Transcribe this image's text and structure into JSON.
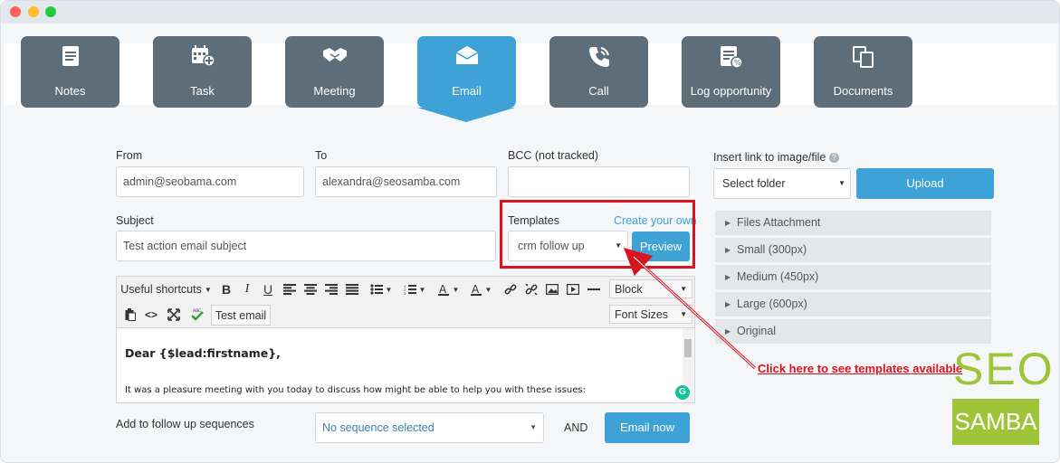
{
  "tabs": [
    {
      "label": "Notes",
      "icon": "notes-icon"
    },
    {
      "label": "Task",
      "icon": "task-calendar-icon"
    },
    {
      "label": "Meeting",
      "icon": "handshake-icon"
    },
    {
      "label": "Email",
      "icon": "envelope-icon"
    },
    {
      "label": "Call",
      "icon": "phone-icon"
    },
    {
      "label": "Log opportunity",
      "icon": "opportunity-icon"
    },
    {
      "label": "Documents",
      "icon": "documents-icon"
    }
  ],
  "form": {
    "from_label": "From",
    "from_value": "admin@seobama.com",
    "to_label": "To",
    "to_value": "alexandra@seosamba.com",
    "bcc_label": "BCC (not tracked)",
    "bcc_value": "",
    "subject_label": "Subject",
    "subject_value": "Test action email subject",
    "templates_label": "Templates",
    "create_own_link": "Create your own",
    "template_selected": "crm follow up",
    "preview_button": "Preview"
  },
  "toolbar": {
    "useful_shortcuts": "Useful shortcuts",
    "bold": "B",
    "italic": "I",
    "underline": "U",
    "block": "Block",
    "test_email": "Test email",
    "font_sizes": "Font Sizes"
  },
  "editor": {
    "greeting": "Dear {$lead:firstname},",
    "body": "It was a pleasure meeting with you today to discuss how  might be able to help you with these issues:"
  },
  "footer": {
    "sequence_label": "Add to follow up sequences",
    "sequence_value": "No sequence selected",
    "and_label": "AND",
    "email_now_button": "Email now"
  },
  "side": {
    "insert_link_label": "Insert link to image/file",
    "folder_select": "Select folder",
    "upload_button": "Upload",
    "accordion": [
      "Files Attachment",
      "Small (300px)",
      "Medium (450px)",
      "Large (600px)",
      "Original"
    ]
  },
  "annotation": {
    "callout": "Click here to see templates available"
  },
  "logo": {
    "line1": "SEO",
    "line2": "SAMBA"
  },
  "colors": {
    "tab_bg": "#5d6e7a",
    "tab_active": "#3fa2d6",
    "accent_red": "#d8141f",
    "logo_green": "#9fc43a"
  }
}
